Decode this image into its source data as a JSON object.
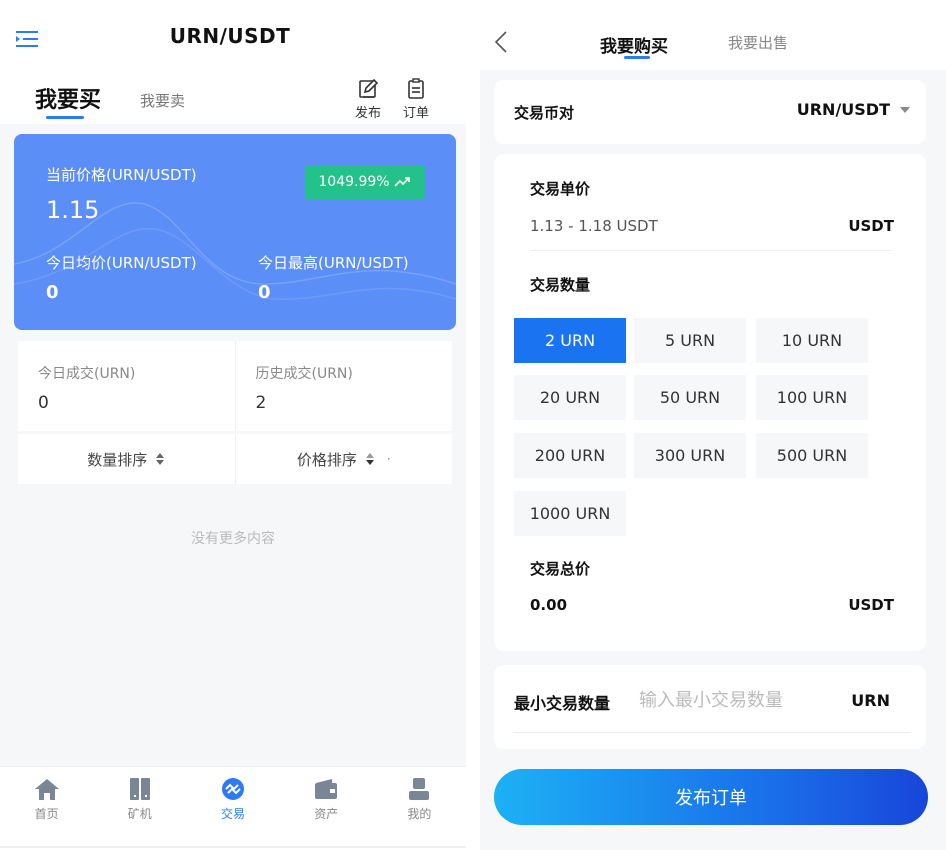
{
  "left": {
    "title": "URN/USDT",
    "tabs": {
      "active": "我要买",
      "inactive": "我要卖"
    },
    "tools": {
      "publish": "发布",
      "orders": "订单"
    },
    "price_card": {
      "current_label": "当前价格(URN/USDT)",
      "current_value": "1.15",
      "change_badge": "1049.99%",
      "avg_label": "今日均价(URN/USDT)",
      "avg_value": "0",
      "high_label": "今日最高(URN/USDT)",
      "high_value": "0"
    },
    "stats": {
      "today_label": "今日成交(URN)",
      "today_value": "0",
      "history_label": "历史成交(URN)",
      "history_value": "2"
    },
    "sorts": {
      "quantity": "数量排序",
      "price": "价格排序",
      "dot": "·"
    },
    "empty_text": "没有更多内容",
    "nav": [
      "首页",
      "矿机",
      "交易",
      "资产",
      "我的"
    ]
  },
  "right": {
    "tabs": {
      "active": "我要购买",
      "inactive": "我要出售"
    },
    "pair": {
      "label": "交易币对",
      "value": "URN/USDT"
    },
    "unit_price": {
      "label": "交易单价",
      "range": "1.13 - 1.18 USDT",
      "unit": "USDT"
    },
    "quantity": {
      "label": "交易数量",
      "options": [
        "2 URN",
        "5 URN",
        "10 URN",
        "20 URN",
        "50 URN",
        "100 URN",
        "200 URN",
        "300 URN",
        "500 URN",
        "1000 URN"
      ],
      "selected": "2 URN"
    },
    "total": {
      "label": "交易总价",
      "value": "0.00",
      "unit": "USDT"
    },
    "min_qty": {
      "label": "最小交易数量",
      "placeholder": "输入最小交易数量",
      "unit": "URN"
    },
    "submit": "发布订单"
  },
  "colors": {
    "accent": "#2d7af5",
    "price_card": "#5b8ef7",
    "badge_green": "#22c28a",
    "selected_qty": "#1a73f0"
  },
  "icons": [
    "menu-icon",
    "edit-icon",
    "clipboard-icon",
    "trend-up-icon",
    "sort-icon",
    "home-icon",
    "miner-icon",
    "exchange-icon",
    "wallet-icon",
    "user-icon",
    "chevron-left-icon",
    "caret-down-icon"
  ]
}
